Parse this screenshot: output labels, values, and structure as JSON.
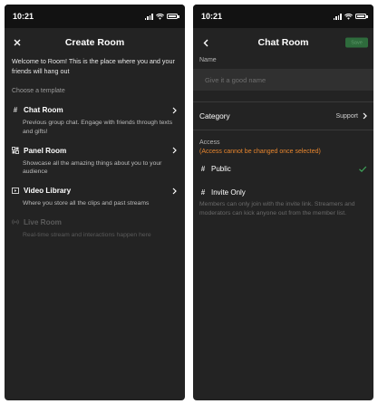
{
  "status": {
    "time_left": "10:21",
    "time_right": "10:21"
  },
  "create_room": {
    "title": "Create Room",
    "welcome": "Welcome to Room! This is the place where you and your friends will hang out",
    "choose_label": "Choose a template",
    "templates": [
      {
        "title": "Chat Room",
        "desc": "Previous group chat. Engage with friends through texts and gifts!",
        "icon": "hash-icon",
        "enabled": true
      },
      {
        "title": "Panel Room",
        "desc": "Showcase all the amazing things about you to your audience",
        "icon": "panel-icon",
        "enabled": true
      },
      {
        "title": "Video Library",
        "desc": "Where you store all the clips and past streams",
        "icon": "video-icon",
        "enabled": true
      },
      {
        "title": "Live Room",
        "desc": "Real-time stream and interactions happen here",
        "icon": "broadcast-icon",
        "enabled": false
      }
    ]
  },
  "chat_room": {
    "title": "Chat Room",
    "save_label": "Save",
    "name_label": "Name",
    "name_placeholder": "Give it a good name",
    "category_label": "Category",
    "category_value": "Support",
    "access_label": "Access",
    "access_warning": "(Access cannot be changed once selected)",
    "options": [
      {
        "label": "Public",
        "selected": true
      },
      {
        "label": "Invite Only",
        "selected": false,
        "desc": "Members can only join with the invite link. Streamers and moderators can kick anyone out from the member list."
      }
    ]
  },
  "colors": {
    "background": "#232323",
    "accent_green": "#2e6b3c",
    "check_green": "#3ea55a",
    "warning_orange": "#e8862e"
  }
}
